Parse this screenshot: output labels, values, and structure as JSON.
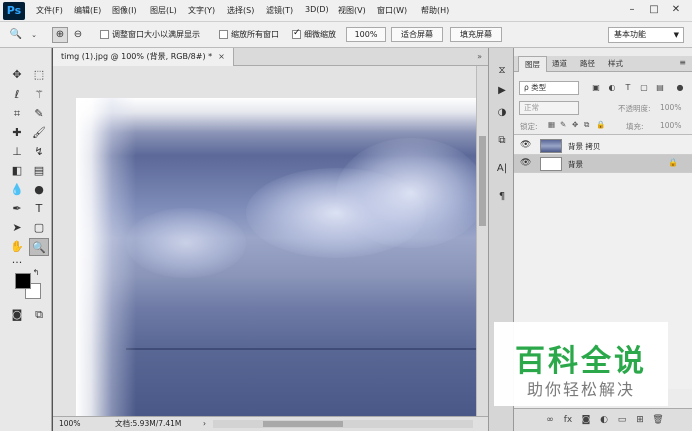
{
  "app": {
    "logo": "Ps"
  },
  "menu": [
    "文件(F)",
    "编辑(E)",
    "图像(I)",
    "图层(L)",
    "文字(Y)",
    "选择(S)",
    "滤镜(T)",
    "3D(D)",
    "视图(V)",
    "窗口(W)",
    "帮助(H)"
  ],
  "window_controls": [
    "–",
    "□",
    "✕"
  ],
  "options": {
    "resize_windows": "调整窗口大小以满屏显示",
    "zoom_all_windows": "缩放所有窗口",
    "scrubby_zoom": "细微缩放",
    "zoom_value": "100%",
    "fit_screen": "适合屏幕",
    "fill_screen": "填充屏幕",
    "workspace": "基本功能",
    "checkboxes": {
      "resize_windows": false,
      "zoom_all_windows": false,
      "scrubby_zoom": true
    }
  },
  "document": {
    "tab_title": "timg (1).jpg @ 100% (背景, RGB/8#) *",
    "tab_close": "×",
    "tab_scroll": "»"
  },
  "status": {
    "zoom": "100%",
    "doc_size": "文档:5.93M/7.41M",
    "arrow": "›"
  },
  "layers_panel": {
    "tabs": [
      "图层",
      "通道",
      "路径",
      "样式"
    ],
    "menu_icon": "≡",
    "filter_kind": "ρ 类型",
    "blend_mode": "正常",
    "opacity_label": "不透明度:",
    "opacity_value": "100%",
    "lock_label": "锁定:",
    "fill_label": "填充:",
    "fill_value": "100%",
    "layers": [
      {
        "name": "背景 拷贝",
        "visible": true,
        "selected": false,
        "locked": false
      },
      {
        "name": "背景",
        "visible": true,
        "selected": true,
        "locked": true
      }
    ]
  },
  "watermark": {
    "title": "百科全说",
    "subtitle": "助你轻松解决"
  }
}
